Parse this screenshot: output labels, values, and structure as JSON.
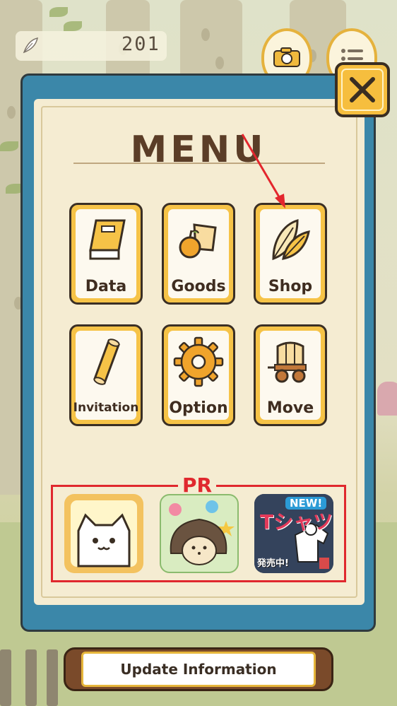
{
  "hud": {
    "feather_count": "201",
    "camera_icon": "camera-icon",
    "list_icon": "list-icon"
  },
  "menu": {
    "title": "MENU",
    "close_icon": "close-icon",
    "tiles": [
      {
        "label": "Data",
        "icon": "book-icon"
      },
      {
        "label": "Goods",
        "icon": "goods-icon"
      },
      {
        "label": "Shop",
        "icon": "feather-icon"
      },
      {
        "label": "Invitation",
        "icon": "scroll-icon"
      },
      {
        "label": "Option",
        "icon": "gear-icon"
      },
      {
        "label": "Move",
        "icon": "wagon-icon"
      }
    ]
  },
  "pr": {
    "label": "PR",
    "apps": [
      {
        "icon": "neko-app-icon"
      },
      {
        "icon": "hedgehog-app-icon"
      },
      {
        "icon": "tshirt-app-icon",
        "badge": "NEW!",
        "text": "Tシャツ",
        "sub": "発売中!"
      }
    ]
  },
  "footer": {
    "update_label": "Update Information"
  },
  "colors": {
    "panel_blue": "#3b87a9",
    "tile_yellow": "#f6c347",
    "pr_red": "#e0282e",
    "annotation_arrow": "#e3262d"
  }
}
